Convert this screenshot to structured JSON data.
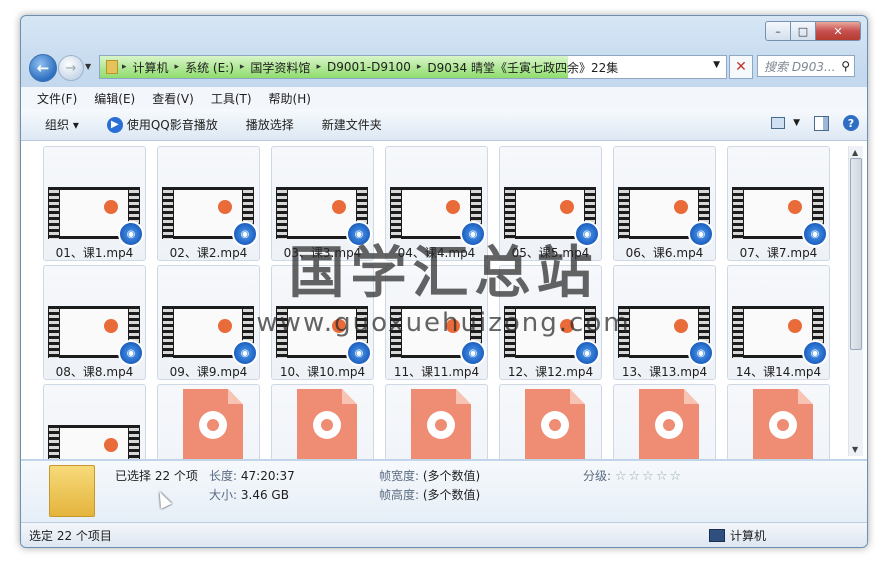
{
  "window": {
    "caption_buttons": {
      "minimize": "–",
      "maximize": "□",
      "close": "✕"
    }
  },
  "address": {
    "crumbs": [
      "计算机",
      "系统 (E:)",
      "国学资料馆",
      "D9001-D9100",
      "D9034 晴堂《壬寅七政四余》22集"
    ],
    "search_placeholder": "搜索 D903..."
  },
  "menu": [
    "文件(F)",
    "编辑(E)",
    "查看(V)",
    "工具(T)",
    "帮助(H)"
  ],
  "toolbar": {
    "organize": "组织 ▾",
    "play_qq": "使用QQ影音播放",
    "play_selection": "播放选择",
    "new_folder": "新建文件夹"
  },
  "files": [
    {
      "name": "01、课1.mp4",
      "type": "video"
    },
    {
      "name": "02、课2.mp4",
      "type": "video"
    },
    {
      "name": "03、课3.mp4",
      "type": "video"
    },
    {
      "name": "04、课4.mp4",
      "type": "video"
    },
    {
      "name": "05、课5.mp4",
      "type": "video"
    },
    {
      "name": "06、课6.mp4",
      "type": "video"
    },
    {
      "name": "07、课7.mp4",
      "type": "video"
    },
    {
      "name": "08、课8.mp4",
      "type": "video"
    },
    {
      "name": "09、课9.mp4",
      "type": "video"
    },
    {
      "name": "10、课10.mp4",
      "type": "video"
    },
    {
      "name": "11、课11.mp4",
      "type": "video"
    },
    {
      "name": "12、课12.mp4",
      "type": "video"
    },
    {
      "name": "13、课13.mp4",
      "type": "video"
    },
    {
      "name": "14、课14.mp4",
      "type": "video"
    },
    {
      "name": "",
      "type": "video"
    },
    {
      "name": "",
      "type": "doc"
    },
    {
      "name": "",
      "type": "doc"
    },
    {
      "name": "",
      "type": "doc"
    },
    {
      "name": "",
      "type": "doc"
    },
    {
      "name": "",
      "type": "doc"
    },
    {
      "name": "",
      "type": "doc"
    }
  ],
  "details": {
    "selected": "已选择 22 个项",
    "length_label": "长度:",
    "length": "47:20:37",
    "size_label": "大小:",
    "size": "3.46 GB",
    "frame_width_label": "帧宽度:",
    "frame_width": "(多个数值)",
    "frame_height_label": "帧高度:",
    "frame_height": "(多个数值)",
    "rating_label": "分级:",
    "rating_stars": "☆☆☆☆☆"
  },
  "status": {
    "left": "选定 22 个项目",
    "right": "计算机"
  },
  "watermark": {
    "title": "国学汇总站",
    "url": "www.guoxuehuizong.com"
  }
}
